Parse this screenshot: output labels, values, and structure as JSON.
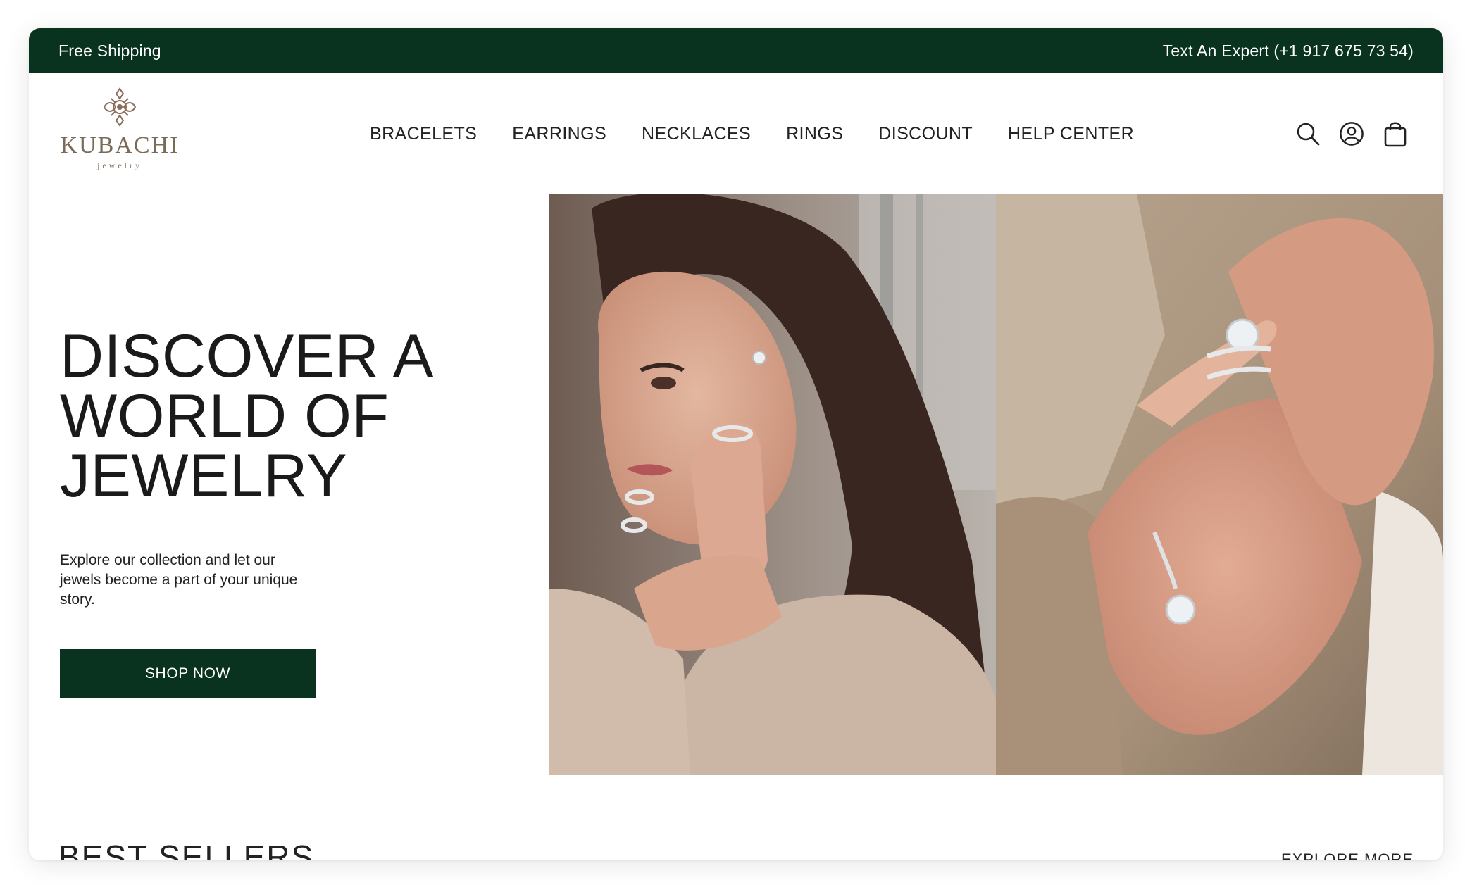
{
  "topbar": {
    "left_text": "Free Shipping",
    "right_text": "Text An Expert (+1 917 675 73 54)"
  },
  "brand": {
    "name": "KUBACHI",
    "tagline": "jewelry",
    "color": "#7a6a58"
  },
  "nav": {
    "items": [
      {
        "label": "BRACELETS"
      },
      {
        "label": "EARRINGS"
      },
      {
        "label": "NECKLACES"
      },
      {
        "label": "RINGS"
      },
      {
        "label": "DISCOUNT"
      },
      {
        "label": "HELP CENTER"
      }
    ]
  },
  "header_icons": [
    "search-icon",
    "account-icon",
    "shopping-bag-icon"
  ],
  "hero": {
    "headline_lines": [
      "DISCOVER A",
      "WORLD OF",
      "JEWELRY"
    ],
    "description": "Explore our collection and let our jewels become a part of your unique story.",
    "cta_label": "SHOP NOW"
  },
  "best_sellers": {
    "title": "BEST SELLERS",
    "explore_label": "EXPLORE MORE"
  },
  "colors": {
    "brand_green": "#0a331f",
    "text": "#1c1c1c"
  }
}
